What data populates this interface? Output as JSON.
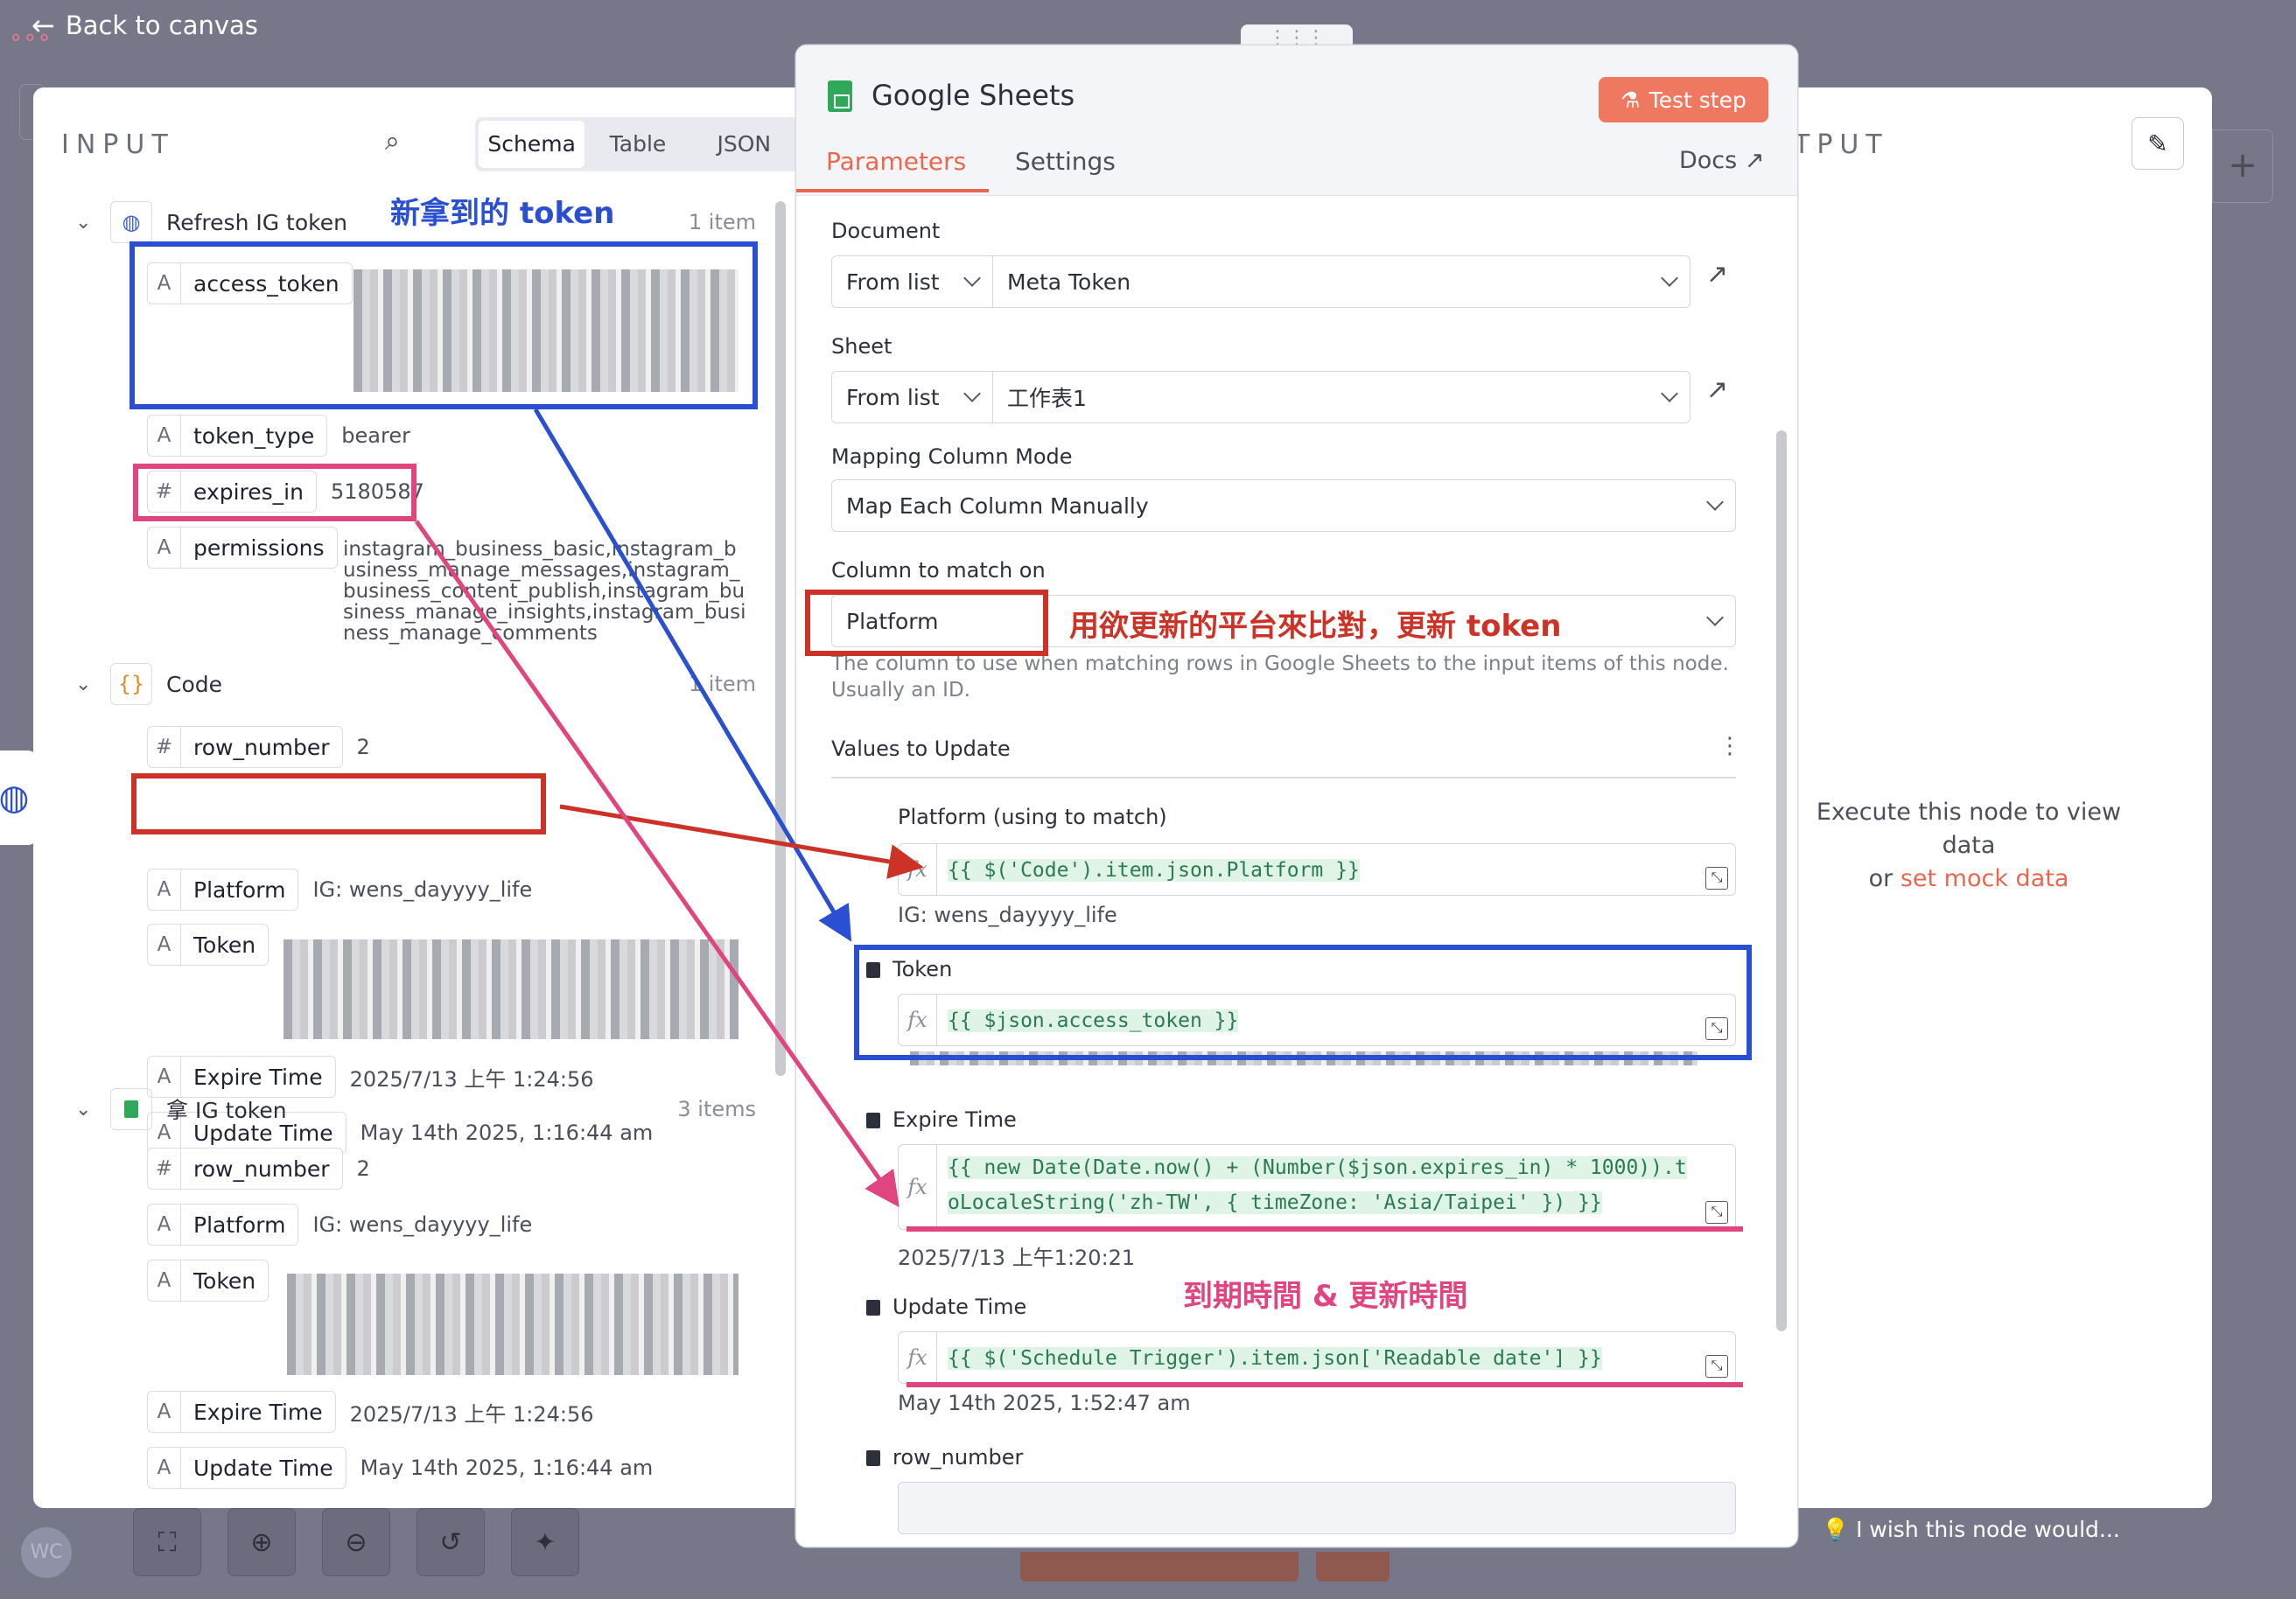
{
  "nav": {
    "back_label": "Back to canvas"
  },
  "input_panel": {
    "title": "INPUT",
    "views": [
      "Schema",
      "Table",
      "JSON"
    ],
    "active_view": "Schema",
    "nodes": [
      {
        "name": "Refresh IG token",
        "count": "1 item",
        "fields": [
          {
            "type": "A",
            "key": "access_token",
            "value": ""
          },
          {
            "type": "A",
            "key": "token_type",
            "value": "bearer"
          },
          {
            "type": "#",
            "key": "expires_in",
            "value": "5180587"
          },
          {
            "type": "A",
            "key": "permissions",
            "value_lines": [
              "instagram_business_basic,instagram_b",
              "usiness_manage_messages,instagram_",
              "business_content_publish,instagram_bu",
              "siness_manage_insights,instagram_busi",
              "ness_manage_comments"
            ]
          }
        ]
      },
      {
        "name": "Code",
        "count": "1 item",
        "fields": [
          {
            "type": "#",
            "key": "row_number",
            "value": "2"
          },
          {
            "type": "A",
            "key": "Platform",
            "value": "IG: wens_dayyyy_life"
          },
          {
            "type": "A",
            "key": "Token",
            "value": ""
          },
          {
            "type": "A",
            "key": "Expire Time",
            "value": "2025/7/13 上午 1:24:56"
          },
          {
            "type": "A",
            "key": "Update Time",
            "value": "May 14th 2025, 1:16:44 am"
          }
        ]
      },
      {
        "name": "拿 IG token",
        "count": "3 items",
        "fields": [
          {
            "type": "#",
            "key": "row_number",
            "value": "2"
          },
          {
            "type": "A",
            "key": "Platform",
            "value": "IG: wens_dayyyy_life"
          },
          {
            "type": "A",
            "key": "Token",
            "value": ""
          },
          {
            "type": "A",
            "key": "Expire Time",
            "value": "2025/7/13 上午 1:24:56"
          },
          {
            "type": "A",
            "key": "Update Time",
            "value": "May 14th 2025, 1:16:44 am"
          }
        ]
      }
    ]
  },
  "node": {
    "title": "Google Sheets",
    "test_label": "Test step",
    "tabs": [
      "Parameters",
      "Settings"
    ],
    "docs_label": "Docs",
    "document": {
      "label": "Document",
      "mode": "From list",
      "value": "Meta Token"
    },
    "sheet": {
      "label": "Sheet",
      "mode": "From list",
      "value": "工作表1"
    },
    "mapping": {
      "label": "Mapping Column Mode",
      "value": "Map Each Column Manually"
    },
    "match": {
      "label": "Column to match on",
      "value": "Platform",
      "hint_lines": [
        "The column to use when matching rows in Google Sheets to the input items of this node.",
        "Usually an ID."
      ]
    },
    "values_label": "Values to Update",
    "values": [
      {
        "label": "Platform (using to match)",
        "expr": "{{ $('Code').item.json.Platform }}",
        "preview": "IG: wens_dayyyy_life"
      },
      {
        "label": "Token",
        "expr": "{{ $json.access_token }}",
        "preview": ""
      },
      {
        "label": "Expire Time",
        "expr_lines": [
          "{{ new Date(Date.now() + (Number($json.expires_in) * 1000)).t",
          "oLocaleString('zh-TW', { timeZone: 'Asia/Taipei' }) }}"
        ],
        "preview": "2025/7/13 上午1:20:21"
      },
      {
        "label": "Update Time",
        "expr": "{{ $('Schedule Trigger').item.json['Readable date'] }}",
        "preview": "May 14th 2025, 1:52:47 am"
      },
      {
        "label": "row_number",
        "expr": "",
        "preview": ""
      }
    ]
  },
  "output_panel": {
    "title": "TPUT",
    "empty_line1": "Execute this node to view data",
    "empty_or": "or ",
    "mock_link": "set mock data"
  },
  "feedback": {
    "label": "I wish this node would..."
  },
  "avatar": {
    "initials": "WC"
  },
  "annotations": {
    "new_token": "新拿到的 token",
    "match_note": "用欲更新的平台來比對，更新 token",
    "time_note": "到期時間 & 更新時間"
  },
  "colors": {
    "blue": "#2a4fd0",
    "red": "#cc3326",
    "pink": "#e0457f",
    "accent": "#e8684f"
  }
}
